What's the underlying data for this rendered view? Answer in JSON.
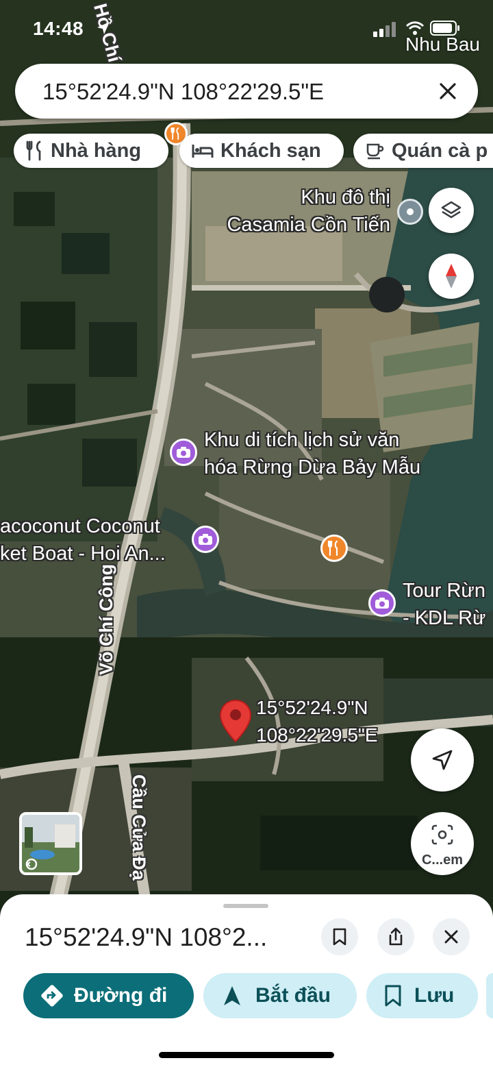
{
  "status_bar": {
    "time": "14:48",
    "location_name": "Nhu Bau"
  },
  "search": {
    "query": "15°52'24.9\"N 108°22'29.5\"E"
  },
  "chips": [
    {
      "label": "Nhà hàng",
      "icon": "fork-knife-icon"
    },
    {
      "label": "Khách sạn",
      "icon": "bed-icon"
    },
    {
      "label": "Quán cà p",
      "icon": "coffee-cup-icon"
    }
  ],
  "map": {
    "place_labels": [
      {
        "line1": "Khu đô thị",
        "line2": "Casamia Cồn Tiến"
      },
      {
        "line1": "Khu di tích lịch sử văn",
        "line2": "hóa Rừng Dừa Bảy Mẫu"
      },
      {
        "line1": "acoconut Coconut",
        "line2": "ket Boat - Hoi An..."
      },
      {
        "line1": "Tour Rừn",
        "line2": "- KDL Rừ"
      }
    ],
    "road_labels": [
      "Võ Chí Công",
      "Cầu Cửa Đạ",
      "Hồ Chí C"
    ],
    "pin_label": {
      "line1": "15°52'24.9\"N",
      "line2": "108°22'29.5\"E"
    },
    "camera_button_label": "C...em"
  },
  "sheet": {
    "title": "15°52'24.9\"N 108°2...",
    "actions": [
      {
        "label": "Đường đi",
        "icon": "directions-icon",
        "primary": true
      },
      {
        "label": "Bắt đầu",
        "icon": "navigation-arrow-icon",
        "primary": false
      },
      {
        "label": "Lưu",
        "icon": "bookmark-icon",
        "primary": false
      }
    ]
  },
  "colors": {
    "primary": "#0b6e78",
    "secondary_bg": "#cfeef5",
    "pin": "#e53935",
    "poi_purple": "#a05cd9",
    "poi_orange": "#f0862a"
  }
}
